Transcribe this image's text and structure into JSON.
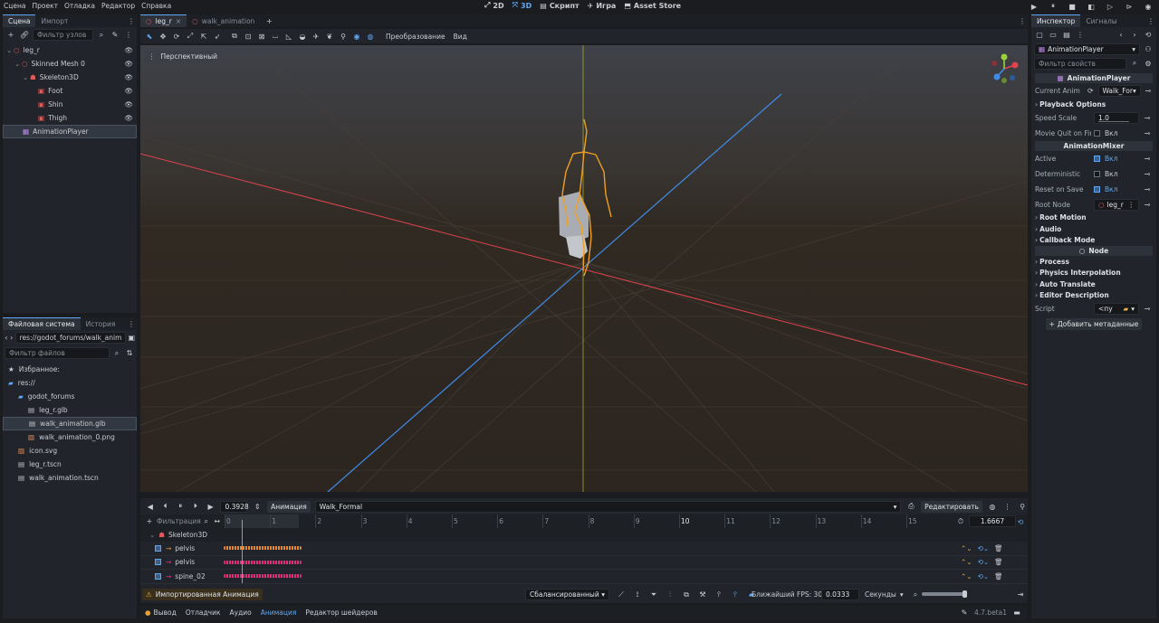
{
  "menu": [
    "Сцена",
    "Проект",
    "Отладка",
    "Редактор",
    "Справка"
  ],
  "workspaces": [
    {
      "icon": "2d-icon",
      "label": "2D",
      "active": false
    },
    {
      "icon": "3d-icon",
      "label": "3D",
      "active": true
    },
    {
      "icon": "script-icon",
      "label": "Скрипт",
      "active": false
    },
    {
      "icon": "game-icon",
      "label": "Игра",
      "active": false
    },
    {
      "icon": "assetlib-icon",
      "label": "Asset Store",
      "active": false
    }
  ],
  "scene_dock": {
    "tabs": [
      "Сцена",
      "Импорт"
    ],
    "filter_placeholder": "Фильтр узлов",
    "nodes": [
      {
        "label": "leg_r",
        "depth": 0,
        "icon": "scene-root-icon",
        "color": "#e05c5c"
      },
      {
        "label": "Skinned Mesh 0",
        "depth": 1,
        "icon": "mesh-icon",
        "color": "#e05c5c"
      },
      {
        "label": "Skeleton3D",
        "depth": 2,
        "icon": "skeleton-icon",
        "color": "#e05c5c"
      },
      {
        "label": "Foot",
        "depth": 3,
        "icon": "bone-attachment-icon",
        "color": "#e05c5c"
      },
      {
        "label": "Shin",
        "depth": 3,
        "icon": "bone-attachment-icon",
        "color": "#e05c5c"
      },
      {
        "label": "Thigh",
        "depth": 3,
        "icon": "bone-attachment-icon",
        "color": "#e05c5c"
      },
      {
        "label": "AnimationPlayer",
        "depth": 1,
        "icon": "animation-player-icon",
        "color": "#c38ef1",
        "selected": true
      }
    ]
  },
  "filesystem": {
    "tabs": [
      "Файловая система",
      "История"
    ],
    "path": "res://godot_forums/walk_anim",
    "filter_placeholder": "Фильтр файлов",
    "items": [
      {
        "label": "Избранное:",
        "depth": 0,
        "icon": "star-icon"
      },
      {
        "label": "res://",
        "depth": 0,
        "icon": "folder-icon"
      },
      {
        "label": "godot_forums",
        "depth": 1,
        "icon": "folder-icon"
      },
      {
        "label": "leg_r.glb",
        "depth": 2,
        "icon": "scene-file-icon"
      },
      {
        "label": "walk_animation.glb",
        "depth": 2,
        "icon": "scene-file-icon",
        "selected": true
      },
      {
        "label": "walk_animation_0.png",
        "depth": 2,
        "icon": "image-file-icon"
      },
      {
        "label": "icon.svg",
        "depth": 1,
        "icon": "image-file-icon"
      },
      {
        "label": "leg_r.tscn",
        "depth": 1,
        "icon": "scene-file-icon"
      },
      {
        "label": "walk_animation.tscn",
        "depth": 1,
        "icon": "scene-file-icon"
      }
    ]
  },
  "editor_tabs": [
    "leg_r",
    "walk_animation"
  ],
  "viewport": {
    "toolbar_menus": [
      "Преобразование",
      "Вид"
    ],
    "perspective_label": "Перспективный"
  },
  "animation": {
    "current_time": "0.3928",
    "anim_button": "Анимация",
    "anim_name": "Walk_Formal",
    "edit_button": "Редактировать",
    "filter_label": "Фильтрация",
    "ruler_ticks": [
      "0",
      "1",
      "2",
      "3",
      "4",
      "5",
      "6",
      "7",
      "8",
      "9",
      "10",
      "11",
      "12",
      "13",
      "14",
      "15"
    ],
    "length": "1.6667",
    "track_group": "Skeleton3D",
    "tracks": [
      "pelvis",
      "pelvis",
      "spine_02"
    ],
    "warning": "Импортированная Анимация",
    "interp_mode": "Сбалансированный",
    "snap_label": "Ближайший FPS: 30",
    "snap_value": "0.0333",
    "unit": "Секунды"
  },
  "bottom_tabs": [
    "Вывод",
    "Отладчик",
    "Аудио",
    "Анимация",
    "Редактор шейдеров"
  ],
  "version": "4.7.beta1",
  "inspector": {
    "tabs": [
      "Инспектор",
      "Сигналы"
    ],
    "object": "AnimationPlayer",
    "filter_placeholder": "Фильтр свойств",
    "header_player": "AnimationPlayer",
    "current_anim_label": "Current Anim",
    "current_anim_value": "Walk_For",
    "playback_options": "Playback Options",
    "speed_scale_label": "Speed Scale",
    "speed_scale_value": "1.0",
    "movie_quit_label": "Movie Quit on Fin",
    "on_label": "Вкл",
    "header_mixer": "AnimationMixer",
    "active_label": "Active",
    "deterministic_label": "Deterministic",
    "reset_label": "Reset on Save",
    "root_node_label": "Root Node",
    "root_node_value": "leg_r",
    "root_motion": "Root Motion",
    "audio": "Audio",
    "callback_mode": "Callback Mode",
    "header_node": "Node",
    "process": "Process",
    "physics_interp": "Physics Interpolation",
    "auto_translate": "Auto Translate",
    "editor_desc": "Editor Description",
    "script_label": "Script",
    "script_value": "<пу",
    "add_metadata": "Добавить метаданные"
  },
  "colors": {
    "accent": "#5fa8f5",
    "x_axis": "#e0434d",
    "z_axis": "#3f8ce8",
    "y_axis": "#b4b43c",
    "skeleton": "#f0a020",
    "track_orange": "#e08a3a",
    "track_pink": "#e0307a"
  }
}
